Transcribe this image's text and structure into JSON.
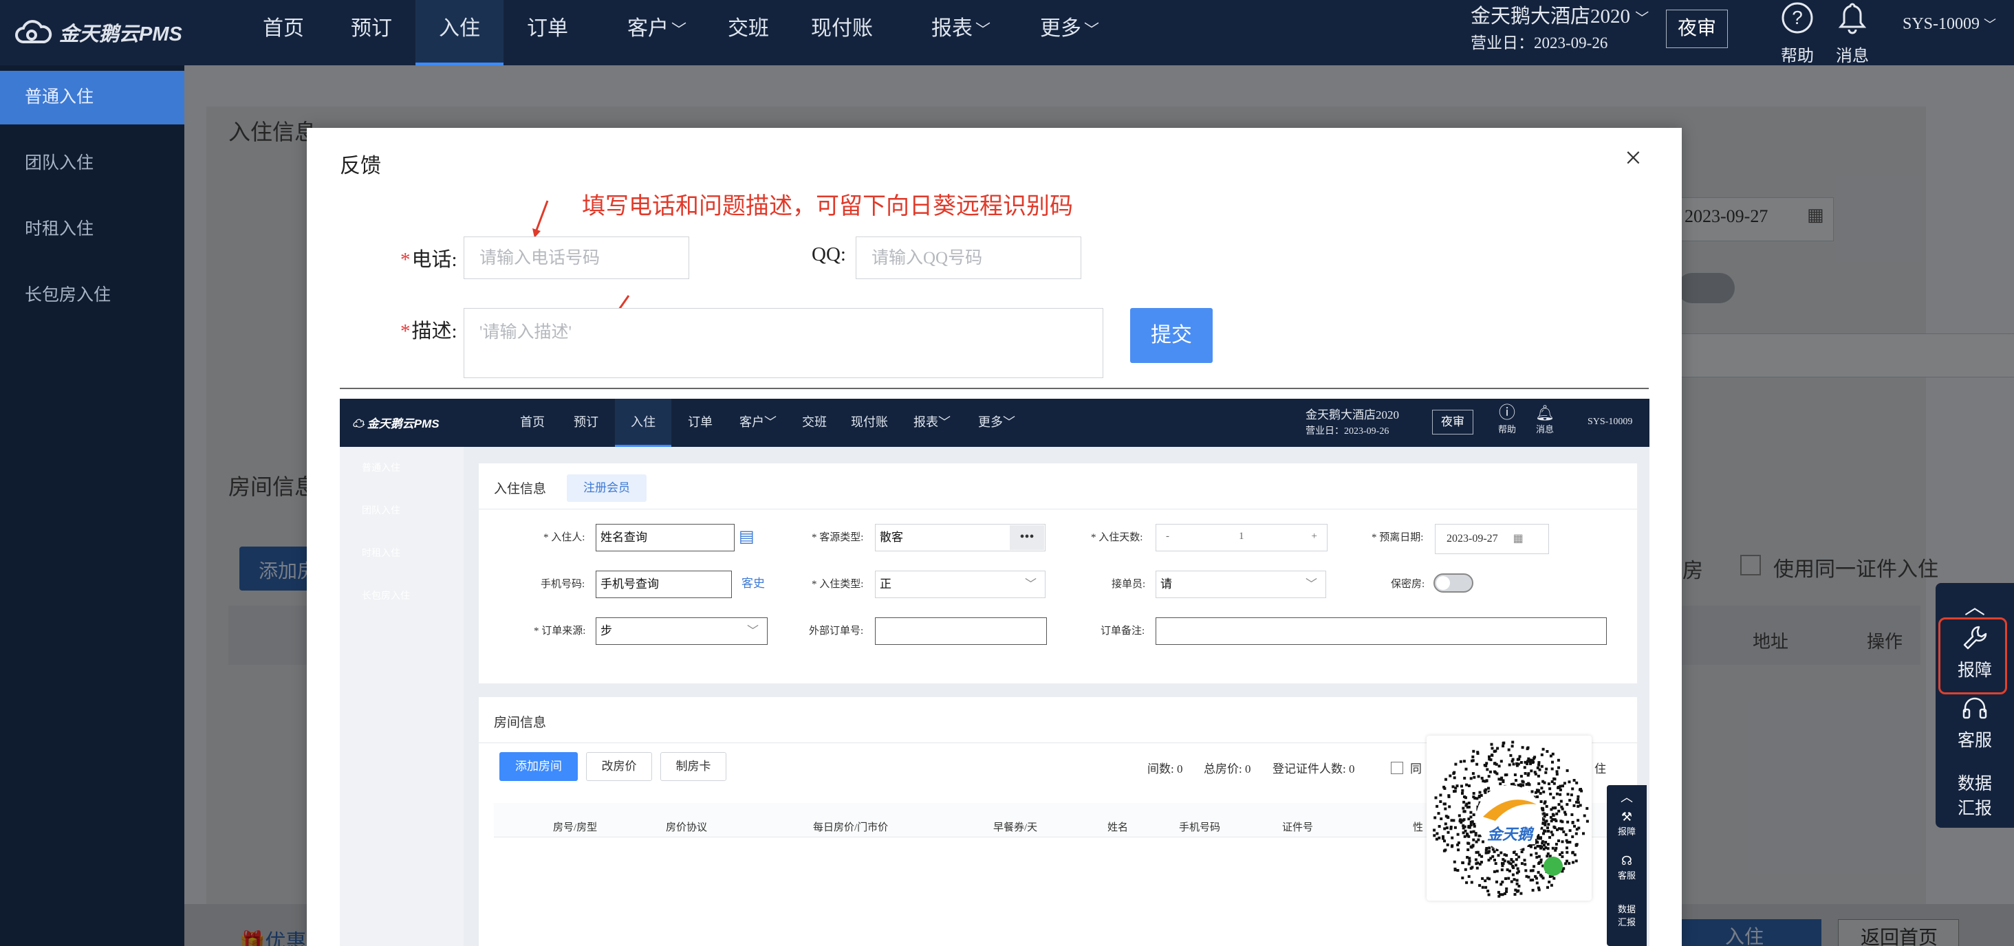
{
  "topbar": {
    "logo": "金天鹅云PMS",
    "nav": [
      {
        "label": "首页",
        "dropdown": false
      },
      {
        "label": "预订",
        "dropdown": false
      },
      {
        "label": "入住",
        "dropdown": false,
        "active": true
      },
      {
        "label": "订单",
        "dropdown": false
      },
      {
        "label": "客户",
        "dropdown": true
      },
      {
        "label": "交班",
        "dropdown": false
      },
      {
        "label": "现付账",
        "dropdown": false
      },
      {
        "label": "报表",
        "dropdown": true
      },
      {
        "label": "更多",
        "dropdown": true
      }
    ],
    "hotel_name": "金天鹅大酒店2020",
    "business_day": "营业日：2023-09-26",
    "night_audit": "夜审",
    "help": "帮助",
    "messages": "消息",
    "user": "SYS-10009"
  },
  "sidebar": {
    "items": [
      {
        "label": "普通入住",
        "active": true
      },
      {
        "label": "团队入住"
      },
      {
        "label": "时租入住"
      },
      {
        "label": "长包房入住"
      }
    ]
  },
  "background": {
    "checkin_info": "入住信息",
    "register_member": "注册会员",
    "date": "2023-09-27",
    "room_info": "房间信息",
    "add_room": "添加房",
    "fangs": "房",
    "same_id": "使用同一证件入住",
    "col_address": "地址",
    "col_action": "操作",
    "checkin_btn": "入住",
    "back_home": "返回首页",
    "bottom_left": "优惠"
  },
  "rail": {
    "up": "︿",
    "report": "报障",
    "service": "客服",
    "data_1": "数据",
    "data_2": "汇报"
  },
  "modal": {
    "title": "反馈",
    "close": "×",
    "annotation": "填写电话和问题描述，可留下向日葵远程识别码",
    "phone_label": "电话:",
    "phone_placeholder": "请输入电话号码",
    "qq_label": "QQ:",
    "qq_placeholder": "请输入QQ号码",
    "desc_label": "描述:",
    "desc_placeholder": "'请输入描述'",
    "submit": "提交"
  },
  "shot": {
    "logo": "金天鹅云PMS",
    "nav": [
      "首页",
      "预订",
      "入住",
      "订单",
      "客户",
      "交班",
      "现付账",
      "报表",
      "更多"
    ],
    "hotel_name": "金天鹅大酒店2020",
    "business_day": "营业日：2023-09-26",
    "night_audit": "夜审",
    "help": "帮助",
    "messages": "消息",
    "user": "SYS-10009",
    "side": [
      "普通入住",
      "团队入住",
      "时租入住",
      "长包房入住"
    ],
    "checkin_info": "入住信息",
    "register_member": "注册会员",
    "guest_label": "* 入住人:",
    "guest_value": "姓名查询",
    "source_type_label": "* 客源类型:",
    "source_type_value": "散客",
    "days_label": "* 入住天数:",
    "days_value": "1",
    "leave_label": "* 预离日期:",
    "leave_value": "2023-09-27",
    "phone_label": "手机号码:",
    "phone_value": "手机号查询",
    "history": "客史",
    "checkin_type_label": "* 入住类型:",
    "checkin_type_value": "正",
    "receptionist_label": "接单员:",
    "receptionist_value": "请",
    "secret_label": "保密房:",
    "order_source_label": "* 订单来源:",
    "order_source_value": "步",
    "ext_order_label": "外部订单号:",
    "order_note_label": "订单备注:",
    "room_info": "房间信息",
    "add_room": "添加房间",
    "change_price": "改房价",
    "make_card": "制房卡",
    "rooms_count": "间数:  0",
    "total_price": "总房价:  0",
    "id_count": "登记证件人数:  0",
    "same": "同",
    "tail": "住",
    "cols": [
      "房号/房型",
      "房价协议",
      "每日房价/门市价",
      "早餐券/天",
      "姓名",
      "手机号码",
      "证件号",
      "性"
    ],
    "qr_brand": "金天鹅",
    "rail": [
      "︿",
      "报障",
      "客服",
      "数据",
      "汇报"
    ]
  },
  "colors": {
    "topbar": "#14233d",
    "accent": "#3d7ad4",
    "annotation": "#e03a2a",
    "submit": "#4b8ef3"
  }
}
